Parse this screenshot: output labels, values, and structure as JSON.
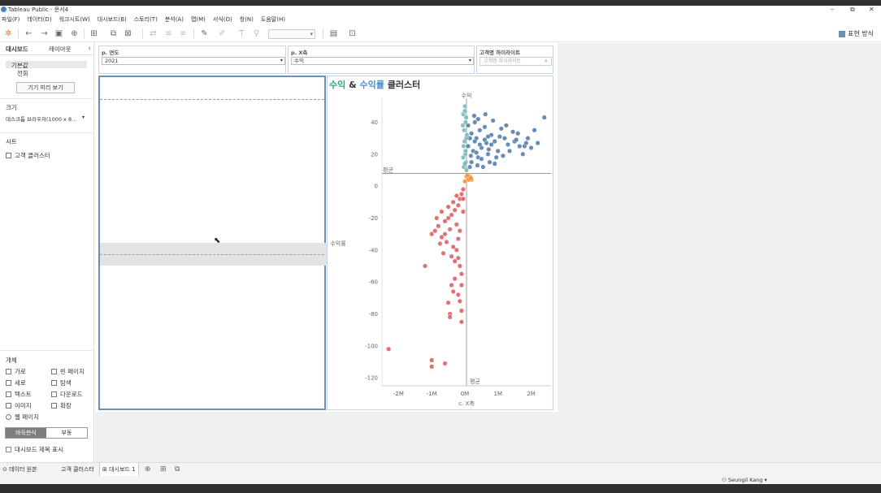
{
  "window": {
    "title": "Tableau Public - 문서4",
    "controls": [
      "–",
      "⧉",
      "✕"
    ]
  },
  "menu": [
    "파일(F)",
    "데이터(D)",
    "워크시트(W)",
    "대시보드(B)",
    "스토리(T)",
    "분석(A)",
    "맵(M)",
    "서식(O)",
    "창(N)",
    "도움말(H)"
  ],
  "toolbar": {
    "show_me": "표현 방식",
    "icons": [
      "tableau-logo-icon",
      "undo-icon",
      "redo-icon",
      "save-icon",
      "new-datasource-icon",
      "new-worksheet-icon",
      "duplicate-icon",
      "clear-icon",
      "swap-icon",
      "sort-asc-icon",
      "sort-desc-icon",
      "highlight-icon",
      "group-icon",
      "label-icon",
      "pin-icon",
      "fit-icon",
      "presentation-icon"
    ]
  },
  "left_pane": {
    "tabs": [
      "대시보드",
      "레이아웃"
    ],
    "device_default": "기본값",
    "device_phone": "전화",
    "device_preview_button": "기기 미리 보기",
    "size_heading": "크기",
    "size_value": "데스크톱 브라우저(1000 x 8...",
    "sheets_heading": "시트",
    "sheet_item": "고객 클러스터",
    "objects_heading": "개체",
    "objects": [
      {
        "label": "가로",
        "icon": "horizontal-icon"
      },
      {
        "label": "빈 페이지",
        "icon": "blank-icon"
      },
      {
        "label": "세로",
        "icon": "vertical-icon"
      },
      {
        "label": "탐색",
        "icon": "navigation-icon"
      },
      {
        "label": "텍스트",
        "icon": "text-icon"
      },
      {
        "label": "다운로드",
        "icon": "download-icon"
      },
      {
        "label": "이미지",
        "icon": "image-icon"
      },
      {
        "label": "확장",
        "icon": "extension-icon"
      },
      {
        "label": "웹 페이지",
        "icon": "web-page-icon"
      }
    ],
    "tiled": "바둑판식",
    "floating": "부동",
    "show_title": "대시보드 제목 표시"
  },
  "filters": {
    "year_label": "p. 연도",
    "year_value": "2021",
    "xaxis_label": "p. X축",
    "xaxis_value": "수익",
    "highlight_label": "고객명 하이라이트",
    "highlight_placeholder": "고객명 하이라이트"
  },
  "chart_data": {
    "type": "scatter",
    "title_parts": [
      "수익",
      " & ",
      "수익률",
      " 클러스터"
    ],
    "xlabel": "c. X축",
    "ylabel": "수익률",
    "top_axis_label": "수익",
    "reference_x_label": "평균",
    "reference_y_label": "평균",
    "x_ticks": [
      "-2M",
      "-1M",
      "0M",
      "1M",
      "2M"
    ],
    "x_tick_values": [
      -2,
      -1,
      0,
      1,
      2
    ],
    "y_ticks": [
      40,
      20,
      0,
      -20,
      -40,
      -60,
      -80,
      -100,
      -120
    ],
    "xlim": [
      -2.5,
      2.6
    ],
    "ylim": [
      -125,
      55
    ],
    "avg_x": 0.05,
    "avg_y": 8,
    "x_unit": "M",
    "clusters": [
      {
        "color": "#4e79a7",
        "points": [
          [
            0.1,
            38
          ],
          [
            0.3,
            40
          ],
          [
            0.6,
            37
          ],
          [
            0.8,
            32
          ],
          [
            1.2,
            30
          ],
          [
            1.5,
            28
          ],
          [
            1.8,
            25
          ],
          [
            2.1,
            35
          ],
          [
            2.4,
            43
          ],
          [
            2.2,
            27
          ],
          [
            1.9,
            30
          ],
          [
            1.6,
            33
          ],
          [
            1.3,
            26
          ],
          [
            1.0,
            22
          ],
          [
            0.7,
            20
          ],
          [
            0.4,
            18
          ],
          [
            0.2,
            15
          ],
          [
            0.15,
            12
          ],
          [
            0.5,
            24
          ],
          [
            0.9,
            28
          ],
          [
            1.1,
            36
          ],
          [
            0.35,
            30
          ],
          [
            0.65,
            27
          ],
          [
            0.85,
            41
          ],
          [
            1.45,
            34
          ],
          [
            1.75,
            20
          ],
          [
            2.0,
            24
          ],
          [
            0.25,
            22
          ],
          [
            0.45,
            35
          ],
          [
            0.55,
            12
          ],
          [
            0.75,
            15
          ],
          [
            0.95,
            18
          ],
          [
            1.35,
            22
          ],
          [
            1.65,
            25
          ],
          [
            0.1,
            25
          ],
          [
            0.3,
            28
          ],
          [
            1.05,
            31
          ],
          [
            0.4,
            42
          ],
          [
            0.6,
            29
          ],
          [
            0.8,
            26
          ],
          [
            1.25,
            38
          ],
          [
            0.2,
            33
          ],
          [
            0.5,
            17
          ],
          [
            0.7,
            31
          ],
          [
            0.9,
            14
          ],
          [
            1.15,
            19
          ],
          [
            0.35,
            21
          ],
          [
            0.15,
            30
          ],
          [
            0.62,
            45
          ],
          [
            0.28,
            44
          ],
          [
            1.55,
            29
          ],
          [
            1.85,
            27
          ],
          [
            0.45,
            26
          ],
          [
            0.72,
            23
          ],
          [
            0.18,
            19
          ],
          [
            0.38,
            13
          ]
        ]
      },
      {
        "color": "#76b7b2",
        "points": [
          [
            0.0,
            50
          ],
          [
            -0.05,
            45
          ],
          [
            0.02,
            40
          ],
          [
            -0.02,
            35
          ],
          [
            0.04,
            30
          ],
          [
            -0.04,
            25
          ],
          [
            0.01,
            20
          ],
          [
            0.03,
            15
          ],
          [
            -0.03,
            12
          ],
          [
            0.05,
            10
          ],
          [
            0.0,
            47
          ],
          [
            -0.06,
            38
          ],
          [
            0.06,
            32
          ],
          [
            -0.01,
            28
          ],
          [
            0.02,
            22
          ],
          [
            -0.05,
            18
          ],
          [
            0.04,
            43
          ],
          [
            0.0,
            14
          ]
        ]
      },
      {
        "color": "#f28e2b",
        "points": [
          [
            0.05,
            6
          ],
          [
            0.1,
            5
          ],
          [
            0.15,
            6
          ],
          [
            0.2,
            4
          ],
          [
            0.0,
            3
          ],
          [
            0.08,
            7
          ],
          [
            0.12,
            4
          ],
          [
            0.18,
            5
          ]
        ]
      },
      {
        "color": "#e15759",
        "points": [
          [
            -0.05,
            -2
          ],
          [
            -0.1,
            -5
          ],
          [
            -0.15,
            -8
          ],
          [
            -0.2,
            -12
          ],
          [
            -0.3,
            -15
          ],
          [
            -0.4,
            -18
          ],
          [
            -0.5,
            -20
          ],
          [
            -0.6,
            -22
          ],
          [
            -0.8,
            -25
          ],
          [
            -0.9,
            -28
          ],
          [
            -1.0,
            -30
          ],
          [
            -0.7,
            -32
          ],
          [
            -0.55,
            -35
          ],
          [
            -0.35,
            -38
          ],
          [
            -0.25,
            -40
          ],
          [
            -0.2,
            -45
          ],
          [
            -0.15,
            -50
          ],
          [
            -0.1,
            -55
          ],
          [
            -0.3,
            -58
          ],
          [
            -0.4,
            -62
          ],
          [
            -0.2,
            -68
          ],
          [
            -0.15,
            -72
          ],
          [
            -0.5,
            -73
          ],
          [
            -0.1,
            -78
          ],
          [
            -0.45,
            -80
          ],
          [
            -0.1,
            -85
          ],
          [
            -1.2,
            -50
          ],
          [
            -0.65,
            -42
          ],
          [
            -0.75,
            -36
          ],
          [
            -0.85,
            -20
          ],
          [
            -0.45,
            -27
          ],
          [
            -0.25,
            -24
          ],
          [
            -0.05,
            -16
          ],
          [
            -0.35,
            -10
          ],
          [
            -0.15,
            -28
          ],
          [
            -0.6,
            -30
          ],
          [
            -0.2,
            -33
          ],
          [
            -0.3,
            -47
          ],
          [
            -0.1,
            -62
          ],
          [
            -0.35,
            -66
          ],
          [
            -2.3,
            -102
          ],
          [
            -1.0,
            -109
          ],
          [
            -1.0,
            -113
          ],
          [
            -0.6,
            -111
          ],
          [
            -0.45,
            -82
          ],
          [
            -0.05,
            -8
          ],
          [
            -0.25,
            -6
          ],
          [
            -0.5,
            -13
          ],
          [
            -0.7,
            -16
          ],
          [
            -0.4,
            -44
          ]
        ]
      }
    ]
  }
}
